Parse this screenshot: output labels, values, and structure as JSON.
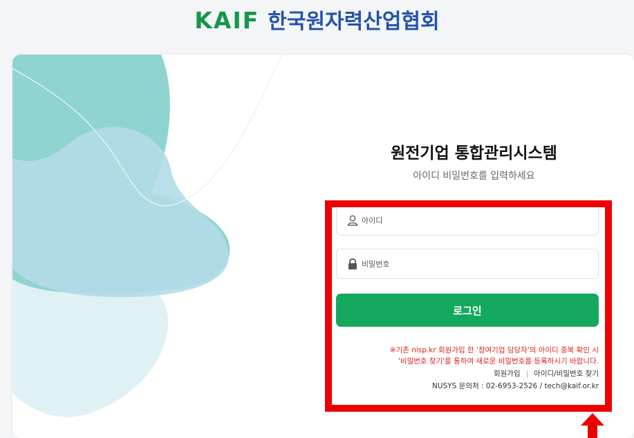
{
  "header": {
    "logo_mark": "KAIF",
    "logo_org": "한국원자력산업협회"
  },
  "login": {
    "title": "원전기업 통합관리시스템",
    "subtitle": "아이디 비밀번호를 입력하세요",
    "id_field": {
      "placeholder": "아이디",
      "value": "",
      "icon": "user-icon"
    },
    "pw_field": {
      "placeholder": "비밀번호",
      "value": "",
      "icon": "lock-icon"
    },
    "login_button": "로그인",
    "notice_line1": "※기존 nisp.kr 회원가입 한 '참여기업 담당자'의 아이디 중복 확인 시",
    "notice_line2": "'비밀번호 찾기'를 통하여 새로운 비밀번호를 등록하시기 바랍니다.",
    "signup_link": "회원가입",
    "separator": "|",
    "find_link": "아이디/비밀번호 찾기",
    "contact": "NUSYS 문의처 : 02-6953-2526 / tech@kaif.or.kr"
  },
  "colors": {
    "accent": "#15a85f",
    "notice": "#e0201b",
    "highlight": "#ee0000",
    "logo_green": "#17964a",
    "logo_blue": "#2553a8"
  },
  "annotation": {
    "highlight_box": "red-rectangle",
    "pointer": "red-up-arrow-icon"
  }
}
